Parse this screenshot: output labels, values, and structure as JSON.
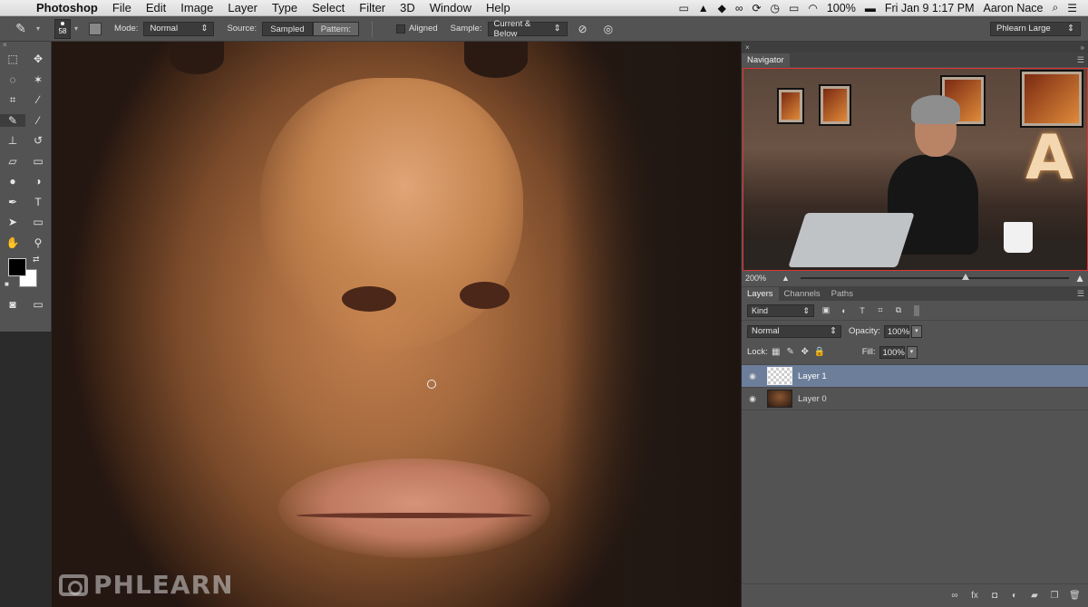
{
  "menubar": {
    "app_name": "Photoshop",
    "items": [
      "File",
      "Edit",
      "Image",
      "Layer",
      "Type",
      "Select",
      "Filter",
      "3D",
      "Window",
      "Help"
    ],
    "status": {
      "battery": "100%",
      "datetime": "Fri Jan 9  1:17 PM",
      "user": "Aaron Nace"
    },
    "icons": [
      "facetime-icon",
      "notification-icon",
      "evernote-icon",
      "creative-cloud-icon",
      "sync-icon",
      "time-machine-icon",
      "airplay-icon",
      "wifi-icon",
      "battery-icon",
      "search-icon",
      "list-icon"
    ]
  },
  "options": {
    "brush_size": "58",
    "mode_label": "Mode:",
    "mode_value": "Normal",
    "source_label": "Source:",
    "source_sampled": "Sampled",
    "source_pattern": "Pattern:",
    "aligned_label": "Aligned",
    "sample_label": "Sample:",
    "sample_value": "Current & Below",
    "workspace": "Phlearn Large"
  },
  "navigator": {
    "title": "Navigator",
    "zoom": "200%"
  },
  "layers_panel": {
    "tabs": [
      "Layers",
      "Channels",
      "Paths"
    ],
    "kind": "Kind",
    "blend_mode": "Normal",
    "opacity_label": "Opacity:",
    "opacity": "100%",
    "lock_label": "Lock:",
    "fill_label": "Fill:",
    "fill": "100%",
    "layers": [
      {
        "name": "Layer 1",
        "selected": true
      },
      {
        "name": "Layer 0",
        "selected": false
      }
    ]
  },
  "canvas": {
    "watermark": "PHLEARN"
  },
  "colors": {
    "selected_layer": "#6d7e9a",
    "panel_bg": "#535353",
    "foreground": "#000000",
    "background": "#ffffff"
  }
}
